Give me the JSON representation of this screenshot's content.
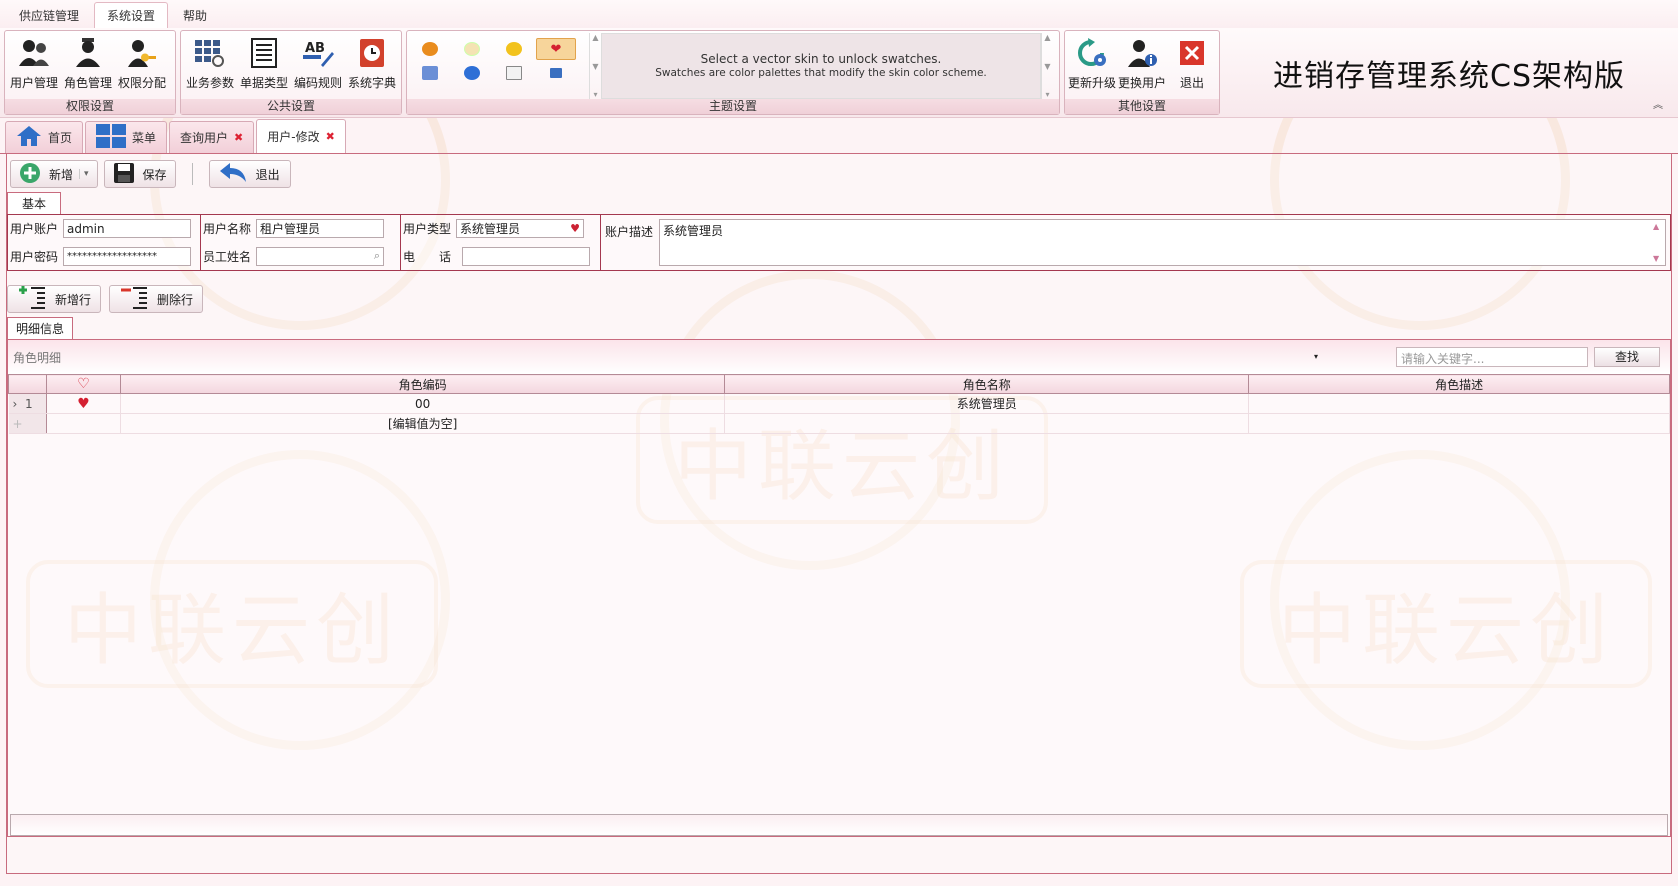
{
  "menu": [
    "供应链管理",
    "系统设置",
    "帮助"
  ],
  "menu_active": 1,
  "ribbon": {
    "groups": [
      {
        "title": "权限设置",
        "items": [
          {
            "label": "用户管理",
            "icon": "users-icon"
          },
          {
            "label": "角色管理",
            "icon": "role-icon"
          },
          {
            "label": "权限分配",
            "icon": "permission-key-icon"
          }
        ]
      },
      {
        "title": "公共设置",
        "items": [
          {
            "label": "业务参数",
            "icon": "grid-settings-icon"
          },
          {
            "label": "单据类型",
            "icon": "document-list-icon"
          },
          {
            "label": "编码规则",
            "icon": "ab-pen-icon"
          },
          {
            "label": "系统字典",
            "icon": "clock-book-icon"
          }
        ]
      },
      {
        "title": "主题设置"
      },
      {
        "title": "其他设置",
        "items": [
          {
            "label": "更新升级",
            "icon": "refresh-gear-icon"
          },
          {
            "label": "更换用户",
            "icon": "user-info-icon"
          },
          {
            "label": "退出",
            "icon": "close-red-icon"
          }
        ]
      }
    ],
    "skin_message_line1": "Select a vector skin to unlock swatches.",
    "skin_message_line2": "Swatches are color palettes that modify the skin color scheme.",
    "brand_title": "进销存管理系统CS架构版"
  },
  "doc_tabs": [
    "首页",
    "菜单",
    "查询用户",
    "用户-修改"
  ],
  "doc_tab_active": 3,
  "toolbar": {
    "new": "新增",
    "save": "保存",
    "exit": "退出"
  },
  "form_tab": "基本",
  "form": {
    "account_label": "用户账户",
    "account_value": "admin",
    "password_label": "用户密码",
    "password_value": "******************",
    "name_label": "用户名称",
    "name_value": "租户管理员",
    "employee_label": "员工姓名",
    "employee_value": "",
    "type_label": "用户类型",
    "type_value": "系统管理员",
    "phone_label": "电　　话",
    "phone_value": "",
    "desc_label": "账户描述",
    "desc_value": "系统管理员"
  },
  "row_tools": {
    "add": "新增行",
    "delete": "删除行"
  },
  "detail_tab": "明细信息",
  "grid": {
    "title": "角色明细",
    "search_placeholder": "请输入关键字...",
    "search_button": "查找",
    "columns": [
      "角色编码",
      "角色名称",
      "角色描述"
    ],
    "rows": [
      {
        "index": "1",
        "code": "00",
        "name": "系统管理员",
        "desc": ""
      }
    ],
    "new_row_hint": "[编辑值为空]"
  },
  "colors": {
    "accent": "#a4384f",
    "heart": "#d42031",
    "bg": "#fdf3f5"
  }
}
